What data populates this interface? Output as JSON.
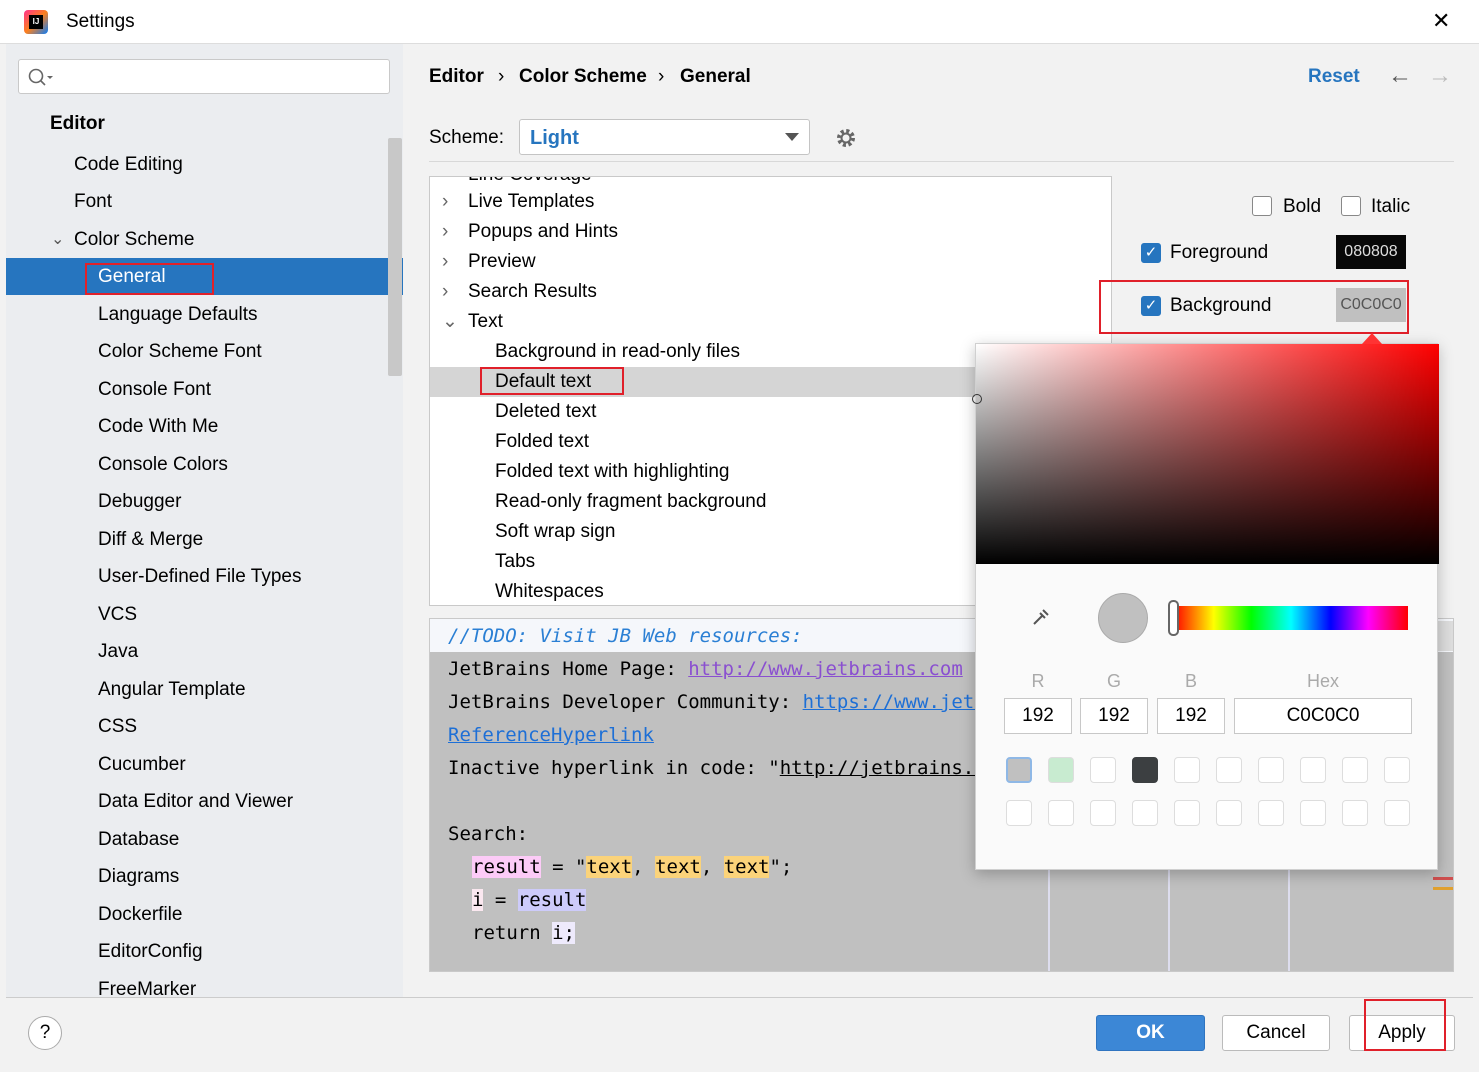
{
  "window": {
    "title": "Settings",
    "close": "✕"
  },
  "sidebar": {
    "search_placeholder": "",
    "section": "Editor",
    "items": [
      {
        "label": "Code Editing"
      },
      {
        "label": "Font"
      },
      {
        "label": "Color Scheme"
      },
      {
        "label": "General"
      },
      {
        "label": "Language Defaults"
      },
      {
        "label": "Color Scheme Font"
      },
      {
        "label": "Console Font"
      },
      {
        "label": "Code With Me"
      },
      {
        "label": "Console Colors"
      },
      {
        "label": "Debugger"
      },
      {
        "label": "Diff & Merge"
      },
      {
        "label": "User-Defined File Types"
      },
      {
        "label": "VCS"
      },
      {
        "label": "Java"
      },
      {
        "label": "Angular Template"
      },
      {
        "label": "CSS"
      },
      {
        "label": "Cucumber"
      },
      {
        "label": "Data Editor and Viewer"
      },
      {
        "label": "Database"
      },
      {
        "label": "Diagrams"
      },
      {
        "label": "Dockerfile"
      },
      {
        "label": "EditorConfig"
      },
      {
        "label": "FreeMarker"
      }
    ]
  },
  "breadcrumb": {
    "items": [
      "Editor",
      "Color Scheme",
      "General"
    ],
    "sep": "›",
    "reset": "Reset",
    "back": "←",
    "forward": "→"
  },
  "scheme": {
    "label": "Scheme:",
    "value": "Light"
  },
  "tree": {
    "partial": "Line Coverage",
    "items": [
      {
        "label": "Live Templates",
        "expander": "›"
      },
      {
        "label": "Popups and Hints",
        "expander": "›"
      },
      {
        "label": "Preview",
        "expander": "›"
      },
      {
        "label": "Search Results",
        "expander": "›"
      },
      {
        "label": "Text",
        "expander": "⌄"
      }
    ],
    "children": [
      "Background in read-only files",
      "Default text",
      "Deleted text",
      "Folded text",
      "Folded text with highlighting",
      "Read-only fragment background",
      "Soft wrap sign",
      "Tabs",
      "Whitespaces"
    ]
  },
  "options": {
    "bold": "Bold",
    "italic": "Italic",
    "foreground": "Foreground",
    "foreground_hex": "080808",
    "background": "Background",
    "background_hex": "C0C0C0",
    "bold_checked": false,
    "italic_checked": false,
    "foreground_checked": true,
    "background_checked": true
  },
  "preview": {
    "todo": "//TODO: Visit JB Web resources:",
    "home_label": "JetBrains Home Page: ",
    "home_link": "http://www.jetbrains.com",
    "community_label": "JetBrains Developer Community: ",
    "community_link": "https://www.jetbrains.com",
    "ref_link": "ReferenceHyperlink",
    "inactive_label": "Inactive hyperlink in code: \"",
    "inactive_link": "http://jetbrains.com",
    "search": "Search:",
    "l1_a": "result",
    "l1_b": " = \"",
    "l1_c": "text",
    "l1_d": ", ",
    "l1_e": "text",
    "l1_f": ", ",
    "l1_g": "text",
    "l1_h": "\";",
    "l2_a": "i",
    "l2_b": " = ",
    "l2_c": "result",
    "l3_a": "return ",
    "l3_b": "i;"
  },
  "picker": {
    "r_label": "R",
    "g_label": "G",
    "b_label": "B",
    "hex_label": "Hex",
    "r": "192",
    "g": "192",
    "b": "192",
    "hex": "C0C0C0",
    "hue": 0
  },
  "footer": {
    "help": "?",
    "ok": "OK",
    "cancel": "Cancel",
    "apply": "Apply"
  }
}
